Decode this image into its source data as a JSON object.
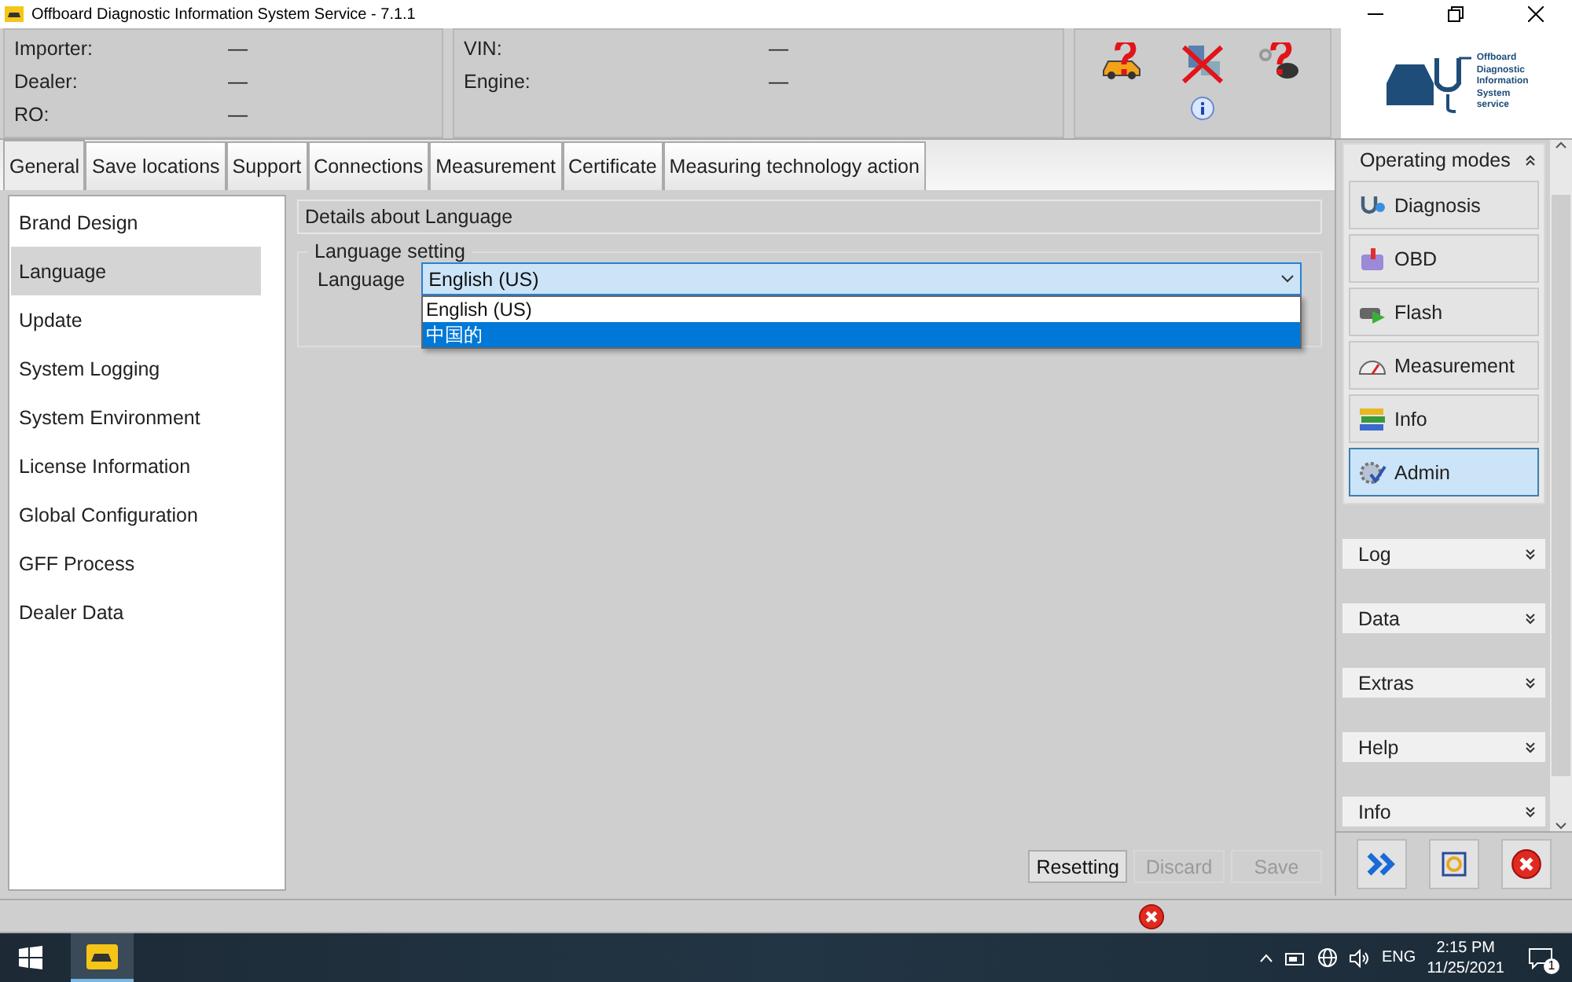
{
  "window": {
    "title": "Offboard Diagnostic Information System Service - 7.1.1"
  },
  "info_panel": [
    {
      "label": "Importer:",
      "value": "—"
    },
    {
      "label": "Dealer:",
      "value": "—"
    },
    {
      "label": "RO:",
      "value": "—"
    }
  ],
  "vehicle_panel": [
    {
      "label": "VIN:",
      "value": "—"
    },
    {
      "label": "Engine:",
      "value": "—"
    }
  ],
  "logo": {
    "lines": [
      "Offboard",
      "Diagnostic",
      "Information",
      "System",
      "service"
    ]
  },
  "tabs": [
    {
      "label": "General",
      "selected": true
    },
    {
      "label": "Save locations",
      "selected": false
    },
    {
      "label": "Support",
      "selected": false
    },
    {
      "label": "Connections",
      "selected": false
    },
    {
      "label": "Measurement",
      "selected": false
    },
    {
      "label": "Certificate",
      "selected": false
    },
    {
      "label": "Measuring technology action",
      "selected": false
    }
  ],
  "sidebar": {
    "items": [
      {
        "label": "Brand Design",
        "selected": false
      },
      {
        "label": "Language",
        "selected": true
      },
      {
        "label": "Update",
        "selected": false
      },
      {
        "label": "System Logging",
        "selected": false
      },
      {
        "label": "System Environment",
        "selected": false
      },
      {
        "label": "License Information",
        "selected": false
      },
      {
        "label": "Global Configuration",
        "selected": false
      },
      {
        "label": "GFF Process",
        "selected": false
      },
      {
        "label": "Dealer Data",
        "selected": false
      }
    ]
  },
  "details": {
    "title": "Details about Language",
    "group": "Language setting",
    "field_label": "Language",
    "value": "English (US)",
    "open": true,
    "options": [
      {
        "label": "English (US)",
        "highlighted": false
      },
      {
        "label": "中国的",
        "highlighted": true
      }
    ]
  },
  "actions": [
    {
      "label": "Resetting",
      "disabled": false
    },
    {
      "label": "Discard",
      "disabled": true
    },
    {
      "label": "Save",
      "disabled": true
    }
  ],
  "operating_modes": {
    "title": "Operating modes",
    "expanded": true,
    "items": [
      {
        "label": "Diagnosis",
        "kind": "stethoscope",
        "selected": false
      },
      {
        "label": "OBD",
        "kind": "obd",
        "selected": false
      },
      {
        "label": "Flash",
        "kind": "flash",
        "selected": false
      },
      {
        "label": "Measurement",
        "kind": "gauge",
        "selected": false
      },
      {
        "label": "Info",
        "kind": "books",
        "selected": false
      },
      {
        "label": "Admin",
        "kind": "gear",
        "selected": true
      }
    ]
  },
  "sections": [
    {
      "title": "Log",
      "expanded": false
    },
    {
      "title": "Data",
      "expanded": false
    },
    {
      "title": "Extras",
      "expanded": false
    },
    {
      "title": "Help",
      "expanded": false
    },
    {
      "title": "Info",
      "expanded": false
    }
  ],
  "taskbar": {
    "language": "ENG",
    "time": "2:15 PM",
    "date": "11/25/2021",
    "notifications": "1"
  }
}
